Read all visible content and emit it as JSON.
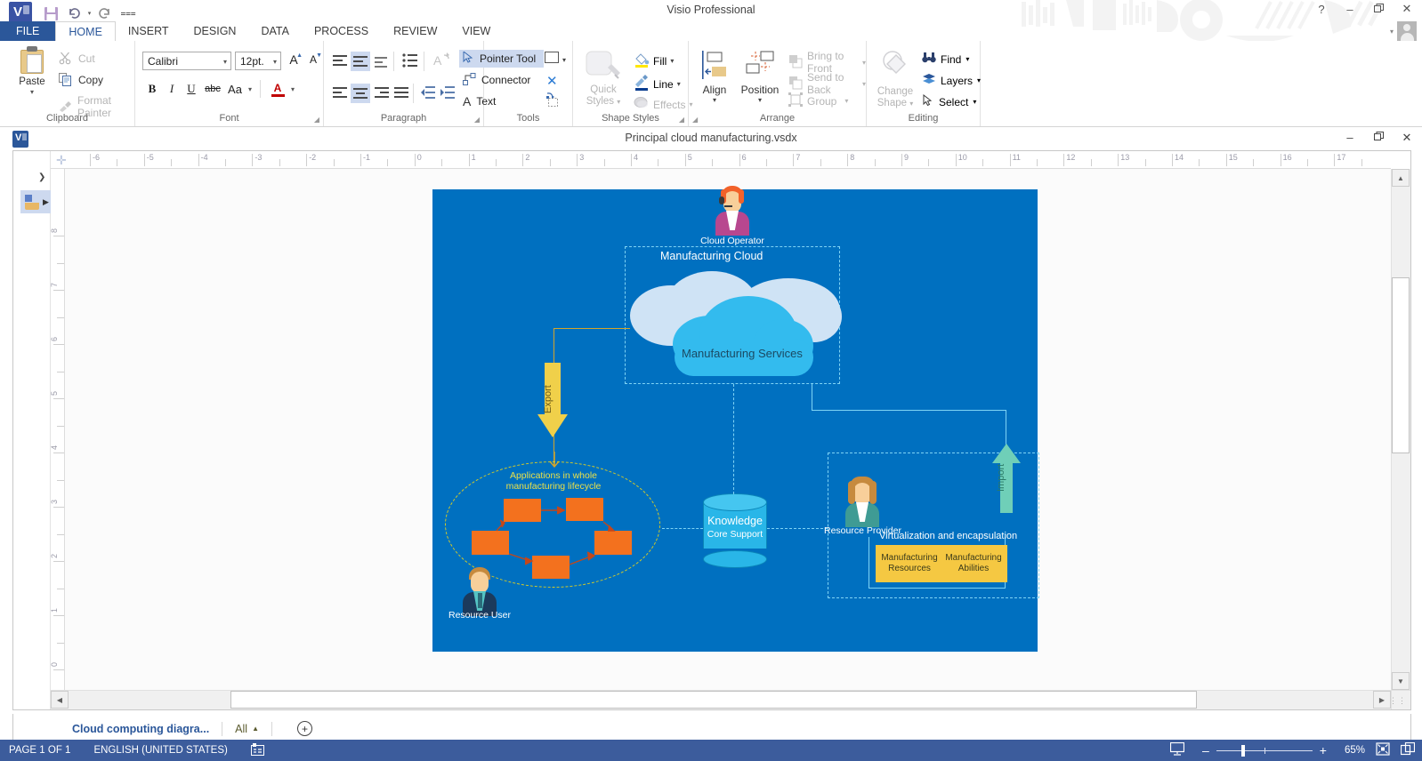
{
  "app": {
    "title": "Visio Professional",
    "quick_access": [
      "save-icon",
      "undo-icon",
      "redo-icon",
      "customize-qat-icon"
    ],
    "window_buttons": {
      "help": "?",
      "minimize": "–",
      "restore": "❐",
      "close": "✕"
    }
  },
  "ribbon": {
    "tabs": [
      {
        "label": "FILE",
        "active": false,
        "special": true
      },
      {
        "label": "HOME",
        "active": true
      },
      {
        "label": "INSERT",
        "active": false
      },
      {
        "label": "DESIGN",
        "active": false
      },
      {
        "label": "DATA",
        "active": false
      },
      {
        "label": "PROCESS",
        "active": false
      },
      {
        "label": "REVIEW",
        "active": false
      },
      {
        "label": "VIEW",
        "active": false
      }
    ],
    "groups": {
      "clipboard": {
        "label": "Clipboard",
        "paste": "Paste",
        "cut": "Cut",
        "copy": "Copy",
        "format_painter": "Format Painter"
      },
      "font": {
        "label": "Font",
        "family": "Calibri",
        "size": "12pt.",
        "grow": "A",
        "shrink": "A",
        "bold": "B",
        "italic": "I",
        "underline": "U",
        "strikethrough": "abc",
        "change_case": "Aa",
        "font_color": "A"
      },
      "paragraph": {
        "label": "Paragraph"
      },
      "tools": {
        "label": "Tools",
        "pointer_tool": "Pointer Tool",
        "connector": "Connector",
        "text": "Text"
      },
      "shape_styles": {
        "label": "Shape Styles",
        "quick_styles": "Quick Styles",
        "fill": "Fill",
        "line": "Line",
        "effects": "Effects"
      },
      "arrange": {
        "label": "Arrange",
        "align": "Align",
        "position": "Position",
        "bring_to_front": "Bring to Front",
        "send_to_back": "Send to Back",
        "group": "Group"
      },
      "editing": {
        "label": "Editing",
        "find": "Find",
        "layers": "Layers",
        "select": "Select"
      }
    }
  },
  "document": {
    "filename": "Principal cloud manufacturing.vsdx",
    "window_buttons": {
      "minimize": "–",
      "restore": "❐",
      "close": "✕"
    }
  },
  "rulers": {
    "horizontal": [
      "-6",
      "-5",
      "-4",
      "-3",
      "-2",
      "-1",
      "0",
      "1",
      "2",
      "3",
      "4",
      "5",
      "6",
      "7",
      "8",
      "9",
      "10",
      "11",
      "12",
      "13",
      "14",
      "15",
      "16",
      "17"
    ],
    "vertical": [
      "8",
      "7",
      "6",
      "5",
      "4",
      "3",
      "2",
      "1",
      "0"
    ]
  },
  "page_tabs": {
    "current_page": "Cloud computing diagra...",
    "all": "All",
    "insert_page": "+"
  },
  "status_bar": {
    "page_info": "PAGE 1 OF 1",
    "language": "ENGLISH (UNITED STATES)",
    "macro_icon": "macro-record-icon",
    "presentation_icon": "presentation-mode-icon",
    "zoom_out": "–",
    "zoom_in": "+",
    "zoom_level": "65%",
    "fit_page_icon": "fit-page-icon",
    "fit_window_icon": "fit-window-icon"
  },
  "diagram": {
    "background_color": "#0070c0",
    "cloud_operator": "Cloud Operator",
    "manufacturing_cloud": "Manufacturing Cloud",
    "manufacturing_services": "Manufacturing Services",
    "export_label": "Export",
    "import_label": "Import",
    "applications_label_line1": "Applications in whole",
    "applications_label_line2": "manufacturing lifecycle",
    "resource_user": "Resource User",
    "resource_provider": "Resource Provider",
    "knowledge_title": "Knowledge",
    "knowledge_sub": "Core Support",
    "virtualization_label": "Virtualization and encapsulation",
    "manufacturing_resources_l1": "Manufacturing",
    "manufacturing_resources_l2": "Resources",
    "manufacturing_abilities_l1": "Manufacturing",
    "manufacturing_abilities_l2": "Abilities",
    "colors": {
      "canvas": "#0070c0",
      "cloud_front": "#33bbee",
      "cloud_back": "#cfe3f5",
      "orange_box": "#f3711e",
      "yellow_panel": "#f5c842",
      "export_arrow": "#f0d04a",
      "import_arrow": "#6fcfb8",
      "dashed_cyan": "#7fd4f5",
      "dashed_yellow": "#d4cb27",
      "cylinder": "#29b6e8"
    },
    "orange_boxes": [
      "box-1",
      "box-2",
      "box-3",
      "box-4",
      "box-5"
    ]
  }
}
